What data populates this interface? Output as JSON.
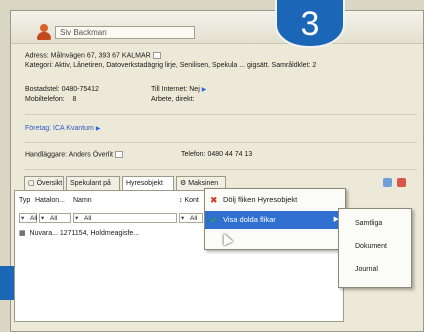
{
  "badge": "3",
  "header": {
    "name_placeholder": "Siv Backman"
  },
  "info": {
    "address": "Adress: Målnvägen 67, 393 67 KALMAR",
    "category": "Kategori: Aktiv, Lånetiren, Datoverkstadägrig lirje, Senilisen, Spekula ... gigsätt. Samråldklet: 2",
    "phone_label": "Bostadstel: 0480-75412",
    "internet_label": "Till Internet: Nej",
    "mobile_label": "Mobiltelefon:",
    "mobile_value": "8",
    "work_label": "Arbete, direkt:",
    "company": "Företag: ICA Kvantum",
    "handler": "Handläggare: Anders Överlit",
    "telephone": "Telefon: 0480 44 74 13"
  },
  "tabs": [
    {
      "label": "Översikt"
    },
    {
      "label": "Spekulant på"
    },
    {
      "label": "Hyresobjekt"
    },
    {
      "label": "Maksinen"
    }
  ],
  "grid": {
    "columns": [
      "Typ",
      "Hatalon...",
      "Namn"
    ],
    "kont_label": "Kont",
    "filter_all": "All",
    "row_text": "Nuvara... 1271154, Holdmeagisfe..."
  },
  "context_menu": {
    "items": [
      {
        "label": "Dölj fliken Hyresobjekt",
        "icon": "close-x-icon"
      },
      {
        "label": "Visa dolda flikar",
        "icon": "checkmark-icon"
      }
    ]
  },
  "submenu": {
    "items": [
      "Samtliga",
      "Dokument",
      "Journal"
    ]
  },
  "colors": {
    "accent_blue": "#1c66b8",
    "menu_highlight": "#2f6fd0",
    "person_icon": "#d9622b"
  }
}
